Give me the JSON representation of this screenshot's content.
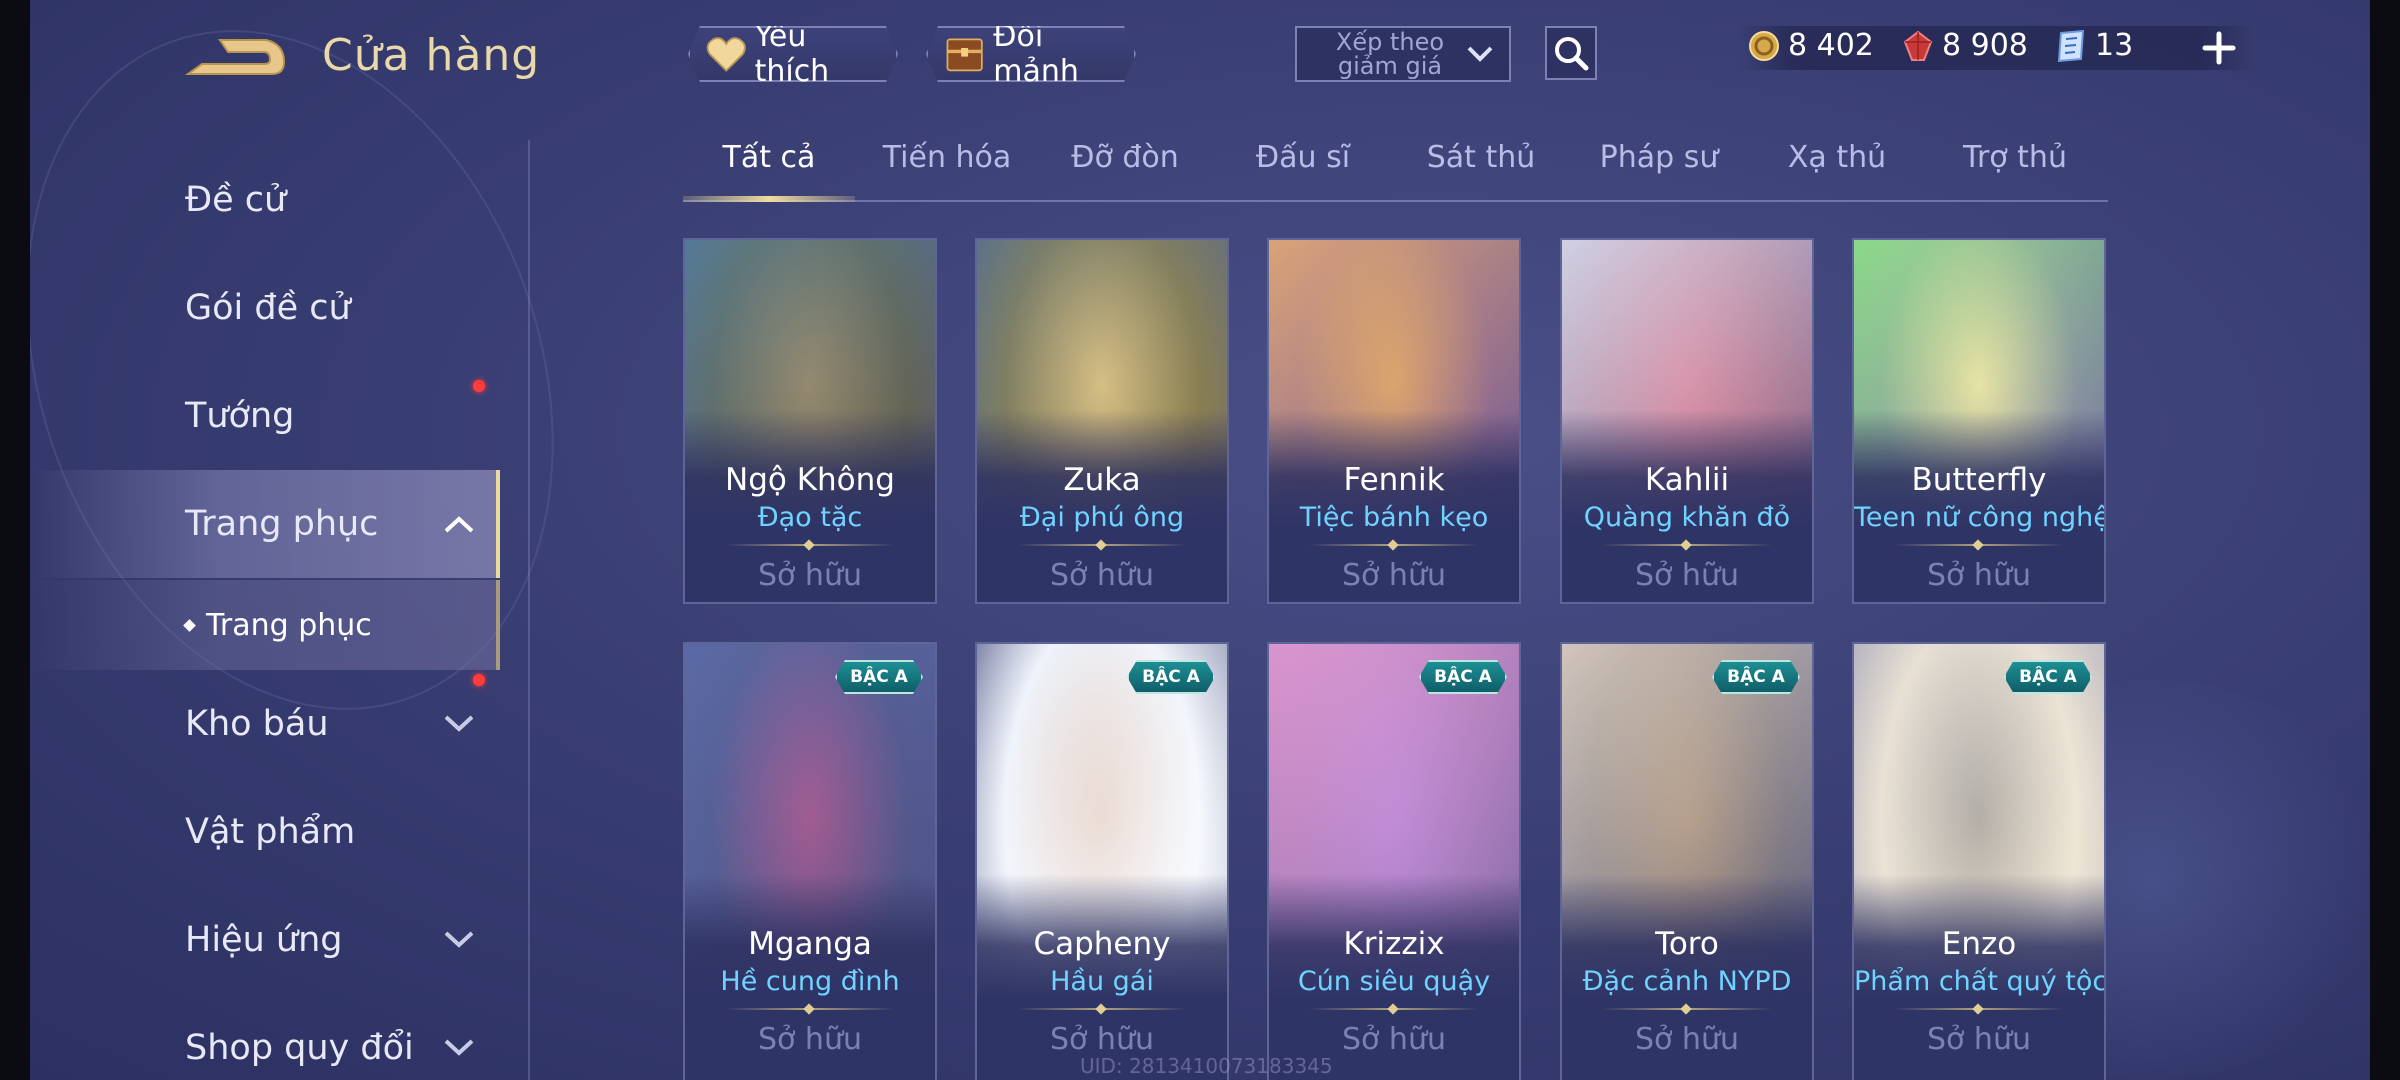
{
  "header": {
    "title": "Cửa hàng",
    "favorites_label": "Yêu thích",
    "shard_label": "Đổi mảnh",
    "sort_label": "Xếp theo giảm giá",
    "currencies": [
      {
        "icon": "gold-coin-icon",
        "value": "8 402"
      },
      {
        "icon": "ruby-gem-icon",
        "value": "8 908"
      },
      {
        "icon": "voucher-icon",
        "value": "13"
      }
    ]
  },
  "sidebar": {
    "items": [
      {
        "label": "Đề cử"
      },
      {
        "label": "Gói đề cử",
        "dot": true
      },
      {
        "label": "Tướng"
      },
      {
        "label": "Trang phục",
        "expanded": true
      },
      {
        "label": "Kho báu",
        "dot": true
      },
      {
        "label": "Vật phẩm"
      },
      {
        "label": "Hiệu ứng"
      },
      {
        "label": "Shop quy đổi"
      }
    ],
    "sub_item": "Trang phục"
  },
  "tabs": [
    "Tất cả",
    "Tiến hóa",
    "Đỡ đòn",
    "Đấu sĩ",
    "Sát thủ",
    "Pháp sư",
    "Xạ thủ",
    "Trợ thủ"
  ],
  "active_tab": "Tất cả",
  "cards": [
    {
      "hero": "Ngộ Không",
      "skin": "Đạo tặc",
      "status": "Sở hữu",
      "badge": "",
      "palette": [
        "#3a3020",
        "#7a5a30",
        "#2c5c72"
      ]
    },
    {
      "hero": "Zuka",
      "skin": "Đại phú ông",
      "status": "Sở hữu",
      "badge": "",
      "palette": [
        "#5a4a22",
        "#c8a45a",
        "#2c4a5a"
      ]
    },
    {
      "hero": "Fennik",
      "skin": "Tiệc bánh kẹo",
      "status": "Sở hữu",
      "badge": "",
      "palette": [
        "#3a2a5e",
        "#b06a3a",
        "#d0902c"
      ]
    },
    {
      "hero": "Kahlii",
      "skin": "Quàng khăn đỏ",
      "status": "Sở hữu",
      "badge": "",
      "palette": [
        "#5a2a3c",
        "#a32a3a",
        "#c0c6d8"
      ]
    },
    {
      "hero": "Butterfly",
      "skin": "Teen nữ công nghệ",
      "status": "Sở hữu",
      "badge": "",
      "palette": [
        "#4a3a6a",
        "#d8c078",
        "#6ad040"
      ]
    },
    {
      "hero": "Mganga",
      "skin": "Hề cung đình",
      "status": "Sở hữu",
      "badge": "BẬC A",
      "palette": [
        "#2a2a4a",
        "#8a2a4a",
        "#3a4a7a"
      ]
    },
    {
      "hero": "Capheny",
      "skin": "Hầu gái",
      "status": "Sở hữu",
      "badge": "BẬC A",
      "palette": [
        "#e8eef8",
        "#d8b8a0",
        "#2a2a3a"
      ]
    },
    {
      "hero": "Krizzix",
      "skin": "Cún siêu quậy",
      "status": "Sở hữu",
      "badge": "BẬC A",
      "palette": [
        "#4a3a6a",
        "#6a4aa0",
        "#d07ab0"
      ]
    },
    {
      "hero": "Toro",
      "skin": "Đặc cảnh NYPD",
      "status": "Sở hữu",
      "badge": "BẬC A",
      "palette": [
        "#2a2a3a",
        "#6a4a30",
        "#c8b8a0"
      ]
    },
    {
      "hero": "Enzo",
      "skin": "Phẩm chất quý tộc",
      "status": "Sở hữu",
      "badge": "BẬC A",
      "palette": [
        "#c8b89a",
        "#2a2a30",
        "#8a8a90"
      ]
    }
  ],
  "uid_text": "UID: 2813410073183345",
  "colors": {
    "accent_gold": "#ead9a0",
    "skin_name": "#6fd3ff",
    "notification": "#ff3b3b"
  }
}
